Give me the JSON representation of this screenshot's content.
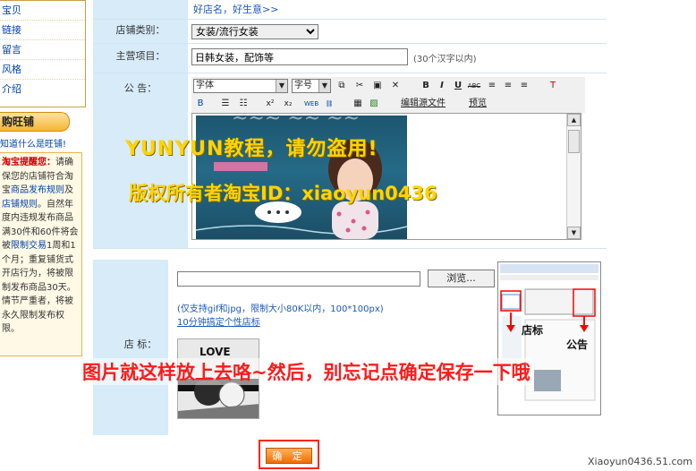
{
  "sidebar": {
    "items": [
      {
        "label": "宝贝"
      },
      {
        "label": "链接"
      },
      {
        "label": "留言"
      },
      {
        "label": "风格"
      },
      {
        "label": "介绍"
      }
    ],
    "wangpu_button": "购旺铺",
    "what_link": "知道什么是旺铺!",
    "notice": {
      "title": "淘宝提醒您：",
      "text_1": "请",
      "text_2": "确保您的店铺符合",
      "text_3": "淘宝",
      "rules_link": "商品发布规则",
      "text_4": "及",
      "shop_rules_link": "店铺规则",
      "text_5": "。自然年度内违规发布商品满30件和60件将会被",
      "limit_link": "限制交易",
      "text_6": "1周和1个月；重复铺货式开店行为，将被限制发布商品30天。情节严重者，将被永久限制发布权限。"
    }
  },
  "form": {
    "row_slogan": {
      "value": "好店名，好生意>>"
    },
    "row_category": {
      "label": "店铺类别：",
      "selected": "女装/流行女装"
    },
    "row_business": {
      "label": "主营项目：",
      "value": "日韩女装，配饰等",
      "hint": "(30个汉字以内)"
    },
    "row_announcement": {
      "label": "公 告：",
      "font_select": "字体",
      "size_select": "字号",
      "btn_bold": "B",
      "btn_italic": "I",
      "btn_underline": "U",
      "btn_strike": "ABC",
      "edit_source": "编辑源文件",
      "preview": "预览"
    },
    "row_logo": {
      "label": "店 标：",
      "browse_label": "浏览...",
      "hint": "(仅支持gif和jpg，限制大小80K以内，100*100px)",
      "link": "10分钟搞定个性店标",
      "preview_text": "LOVE"
    }
  },
  "thumbnail": {
    "label_logo": "店标",
    "label_announcement": "公告"
  },
  "confirm_button": "确 定",
  "watermarks": {
    "line1": "YUNYUN教程，请勿盗用!",
    "line2": "版权所有者淘宝ID：xiaoyun0436",
    "caption": "图片就这样放上去咯~然后，别忘记点确定保存一下哦"
  },
  "footer_url": "Xiaoyun0436.51.com",
  "colors": {
    "label_bg": "#d7ebf9",
    "link": "#1c58b8",
    "watermark": "#ffd400",
    "caption": "#ff1a1a",
    "confirm": "#f36c00"
  }
}
